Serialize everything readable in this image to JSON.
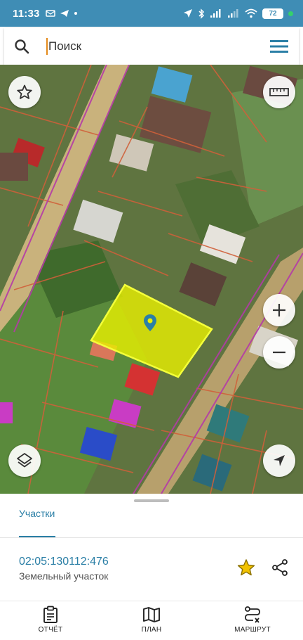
{
  "status_bar": {
    "time": "11:33",
    "battery": "72"
  },
  "search": {
    "placeholder": "Поиск"
  },
  "sheet": {
    "tab_label": "Участки",
    "parcel_id": "02:05:130112:476",
    "parcel_type": "Земельный участок"
  },
  "nav": {
    "report_label": "ОТЧЁТ",
    "plan_label": "ПЛАН",
    "route_label": "МАРШРУТ"
  },
  "colors": {
    "accent": "#2b7fa6",
    "status_bar": "#3f8db5",
    "parcel_fill": "#e8f000",
    "cadastral_lines": "#d0603a",
    "road_lines": "#b43aa8",
    "favorite_star": "#f2c200"
  }
}
